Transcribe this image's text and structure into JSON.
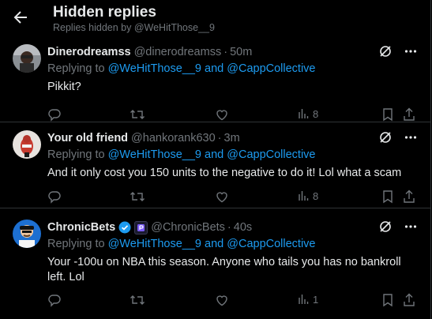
{
  "header": {
    "title": "Hidden replies",
    "subtitle": "Replies hidden by @WeHitThose__9"
  },
  "tweets": [
    {
      "name": "Dinerodreamss",
      "handle": "@dinerodreamss",
      "time": "50m",
      "replying_prefix": "Replying to",
      "replying_links": "@WeHitThose__9 and @CappCollective",
      "text": "Pikkit?",
      "views": "8",
      "verified": false
    },
    {
      "name": "Your old friend",
      "handle": "@hankorank630",
      "time": "3m",
      "replying_prefix": "Replying to",
      "replying_links": "@WeHitThose__9 and @CappCollective",
      "text": "And it only cost you 150 units to the negative to do it! Lol what a scam",
      "views": "8",
      "verified": false
    },
    {
      "name": "ChronicBets",
      "handle": "@ChronicBets",
      "time": "40s",
      "replying_prefix": "Replying to",
      "replying_links": "@WeHitThose__9 and @CappCollective",
      "text": "Your -100u on NBA this season. Anyone who tails you has no bankroll left. Lol",
      "views": "1",
      "verified": true
    }
  ],
  "colors": {
    "background": "#000000",
    "text": "#e7e9ea",
    "muted": "#71767b",
    "link": "#1d9bf0",
    "divider": "#2f3336"
  },
  "icons": [
    "back-arrow-icon",
    "hide-reply-icon",
    "more-icon",
    "reply-icon",
    "retweet-icon",
    "like-icon",
    "views-icon",
    "bookmark-icon",
    "share-icon",
    "verified-icon",
    "affiliate-badge-icon"
  ]
}
